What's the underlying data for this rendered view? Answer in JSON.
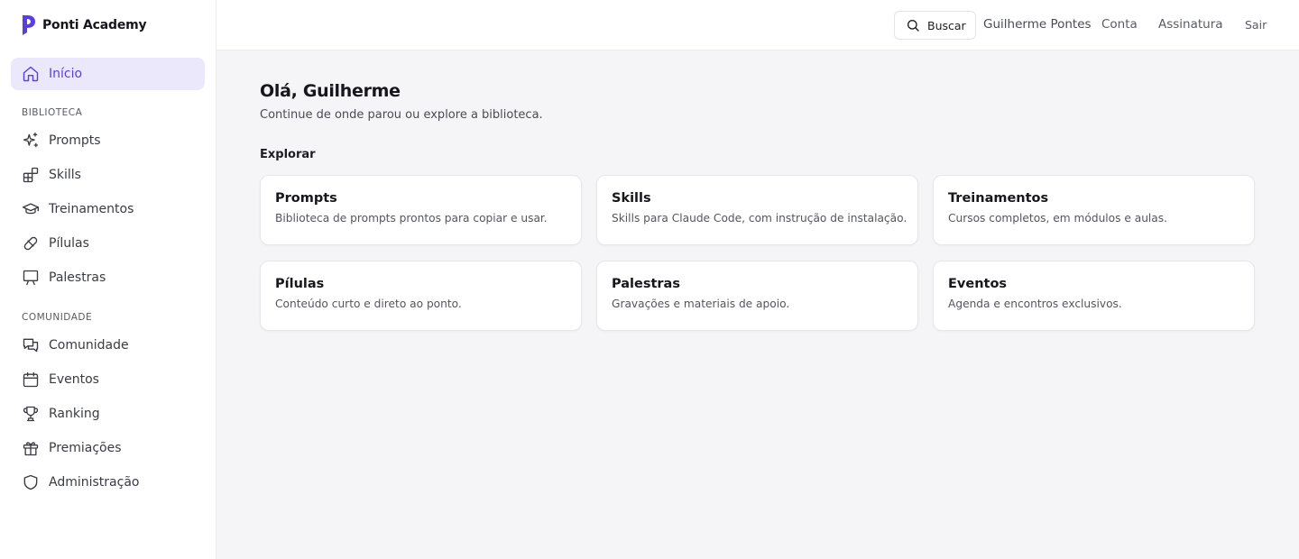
{
  "brand": {
    "name": "Ponti Academy",
    "accent": "#5b3fd8"
  },
  "sidebar": {
    "home": {
      "label": "Início",
      "icon": "home-icon"
    },
    "sections": [
      {
        "heading": "BIBLIOTECA",
        "items": [
          {
            "label": "Prompts",
            "icon": "sparkles-icon"
          },
          {
            "label": "Skills",
            "icon": "blocks-icon"
          },
          {
            "label": "Treinamentos",
            "icon": "graduation-cap-icon"
          },
          {
            "label": "Pílulas",
            "icon": "pill-icon"
          },
          {
            "label": "Palestras",
            "icon": "presentation-icon"
          }
        ]
      },
      {
        "heading": "COMUNIDADE",
        "items": [
          {
            "label": "Comunidade",
            "icon": "messages-icon"
          },
          {
            "label": "Eventos",
            "icon": "calendar-icon"
          },
          {
            "label": "Ranking",
            "icon": "trophy-icon"
          },
          {
            "label": "Premiações",
            "icon": "gift-icon"
          },
          {
            "label": "Administração",
            "icon": "shield-icon"
          }
        ]
      }
    ]
  },
  "topbar": {
    "search_label": "Buscar",
    "user_name": "Guilherme Pontes",
    "account": "Conta",
    "subscription": "Assinatura",
    "logout": "Sair"
  },
  "main": {
    "greeting": "Olá, Guilherme",
    "subtitle": "Continue de onde parou ou explore a biblioteca.",
    "explore_heading": "Explorar",
    "cards": [
      {
        "title": "Prompts",
        "description": "Biblioteca de prompts prontos para copiar e usar."
      },
      {
        "title": "Skills",
        "description": "Skills para Claude Code, com instrução de instalação."
      },
      {
        "title": "Treinamentos",
        "description": "Cursos completos, em módulos e aulas."
      },
      {
        "title": "Pílulas",
        "description": "Conteúdo curto e direto ao ponto."
      },
      {
        "title": "Palestras",
        "description": "Gravações e materiais de apoio."
      },
      {
        "title": "Eventos",
        "description": "Agenda e encontros exclusivos."
      }
    ]
  }
}
